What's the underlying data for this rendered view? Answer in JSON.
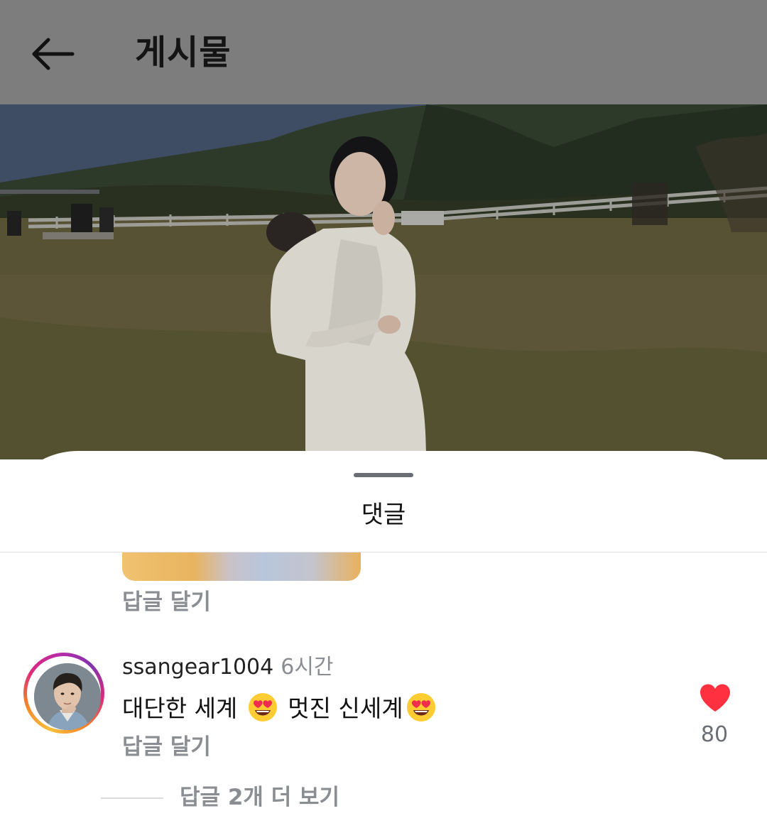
{
  "header": {
    "title": "게시물",
    "back_icon": "arrow-left-icon"
  },
  "post": {
    "photo_description_icon": "post-photo"
  },
  "comments_sheet": {
    "title": "댓글",
    "previous_comment": {
      "reply_label": "답글 달기"
    },
    "comment": {
      "username": "ssangear1004",
      "time": "6시간",
      "text_part1": "대단한 세계",
      "emoji_1": "heart-eyes-emoji",
      "text_part2": "멋진 신세계",
      "emoji_2": "heart-eyes-emoji",
      "reply_label": "답글 달기",
      "like_icon": "heart-icon",
      "like_color": "#ff3040",
      "like_count": "80",
      "more_replies_label": "답글 2개 더 보기"
    }
  },
  "colors": {
    "header_bg": "#7d7d7d",
    "muted_text": "#8a8d92",
    "primary_text": "#121212"
  }
}
